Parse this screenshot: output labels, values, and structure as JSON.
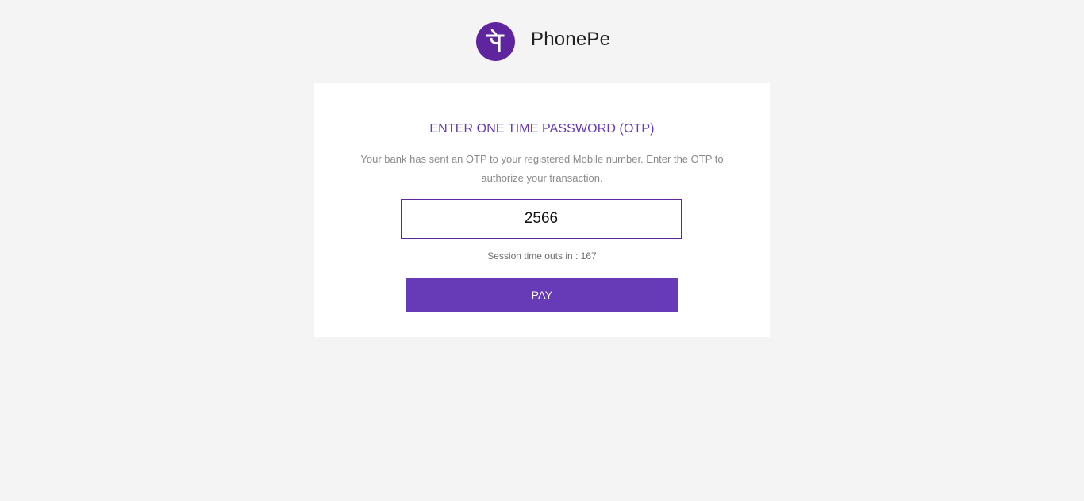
{
  "header": {
    "logo_icon": "phonepe-logo-icon",
    "brand_name": "PhonePe",
    "brand_color": "#5f259f"
  },
  "otp_card": {
    "title": "ENTER ONE TIME PASSWORD (OTP)",
    "description": "Your bank has sent an OTP to your registered Mobile number. Enter the OTP to authorize your transaction.",
    "otp_value": "2566",
    "session_text": "Session time outs in : 167",
    "pay_label": "PAY",
    "accent_color": "#673ab7"
  }
}
